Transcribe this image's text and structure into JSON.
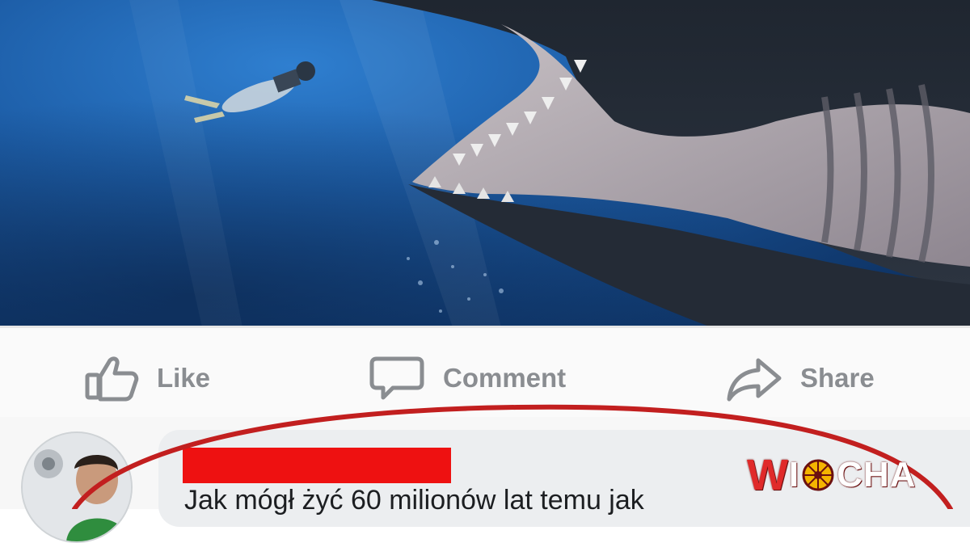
{
  "post": {
    "actions": {
      "like_label": "Like",
      "comment_label": "Comment",
      "share_label": "Share"
    }
  },
  "comment": {
    "text": "Jak mógł żyć 60 milionów lat temu jak"
  },
  "watermark": {
    "prefix": "W",
    "middle": "I",
    "suffix": "CHA"
  },
  "icons": {
    "like": "thumbs-up-icon",
    "comment": "speech-bubble-icon",
    "share": "share-arrow-icon"
  },
  "colors": {
    "action_text": "#8a8d91",
    "highlight_circle": "#c21f1f",
    "redaction": "#ee1111",
    "watermark_accent": "#e02a2a"
  }
}
